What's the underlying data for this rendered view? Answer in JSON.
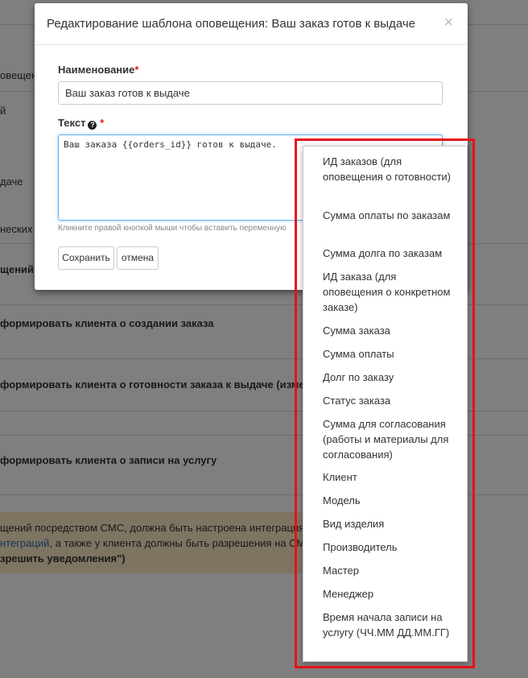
{
  "background": {
    "tab_fragment": "овещени",
    "item_y": "й",
    "item_vydache": "даче",
    "item_tech": "неских",
    "section": "щений",
    "option1": "формировать клиента о создании заказа",
    "option2": "формировать клиента о готовности заказа к выдаче (изменен",
    "option3": "формировать клиента о записи на услугу",
    "notice": {
      "line1": "щений посредством СМС, должна быть настроена интеграция с",
      "line2_link": "нтеграций",
      "line2_rest": ", а также у клиента должны быть разрешения на СМ",
      "line3": "зрешить уведомления\")"
    }
  },
  "modal": {
    "title": "Редактирование шаблона оповещения: Ваш заказ готов к выдаче",
    "close": "×",
    "name_label": "Наименование",
    "required_mark": "*",
    "name_value": "Ваш заказ готов к выдаче",
    "text_label": "Текст",
    "help_icon": "?",
    "text_value": "Ваш заказа {{orders_id}} готов к выдаче.",
    "hint": "Кликните правой кнопкой мыши чтобы вставить переменную",
    "save_label": "Сохранить",
    "cancel_label": "отмена"
  },
  "context_menu": {
    "items": [
      "ИД заказов (для оповещения о готовности)",
      "Сумма оплаты по заказам",
      "Сумма долга по заказам",
      "ИД заказа (для оповещения о конкретном заказе)",
      "Сумма заказа",
      "Сумма оплаты",
      "Долг по заказу",
      "Статус заказа",
      "Сумма для согласования (работы и материалы для согласования)",
      "Клиент",
      "Модель",
      "Вид изделия",
      "Производитель",
      "Мастер",
      "Менеджер",
      "Время начала записи на услугу (ЧЧ.ММ ДД.ММ.ГГ)"
    ]
  },
  "colors": {
    "highlight_border": "#e8101a",
    "required": "#e02020",
    "focus_border": "#66afe9"
  }
}
